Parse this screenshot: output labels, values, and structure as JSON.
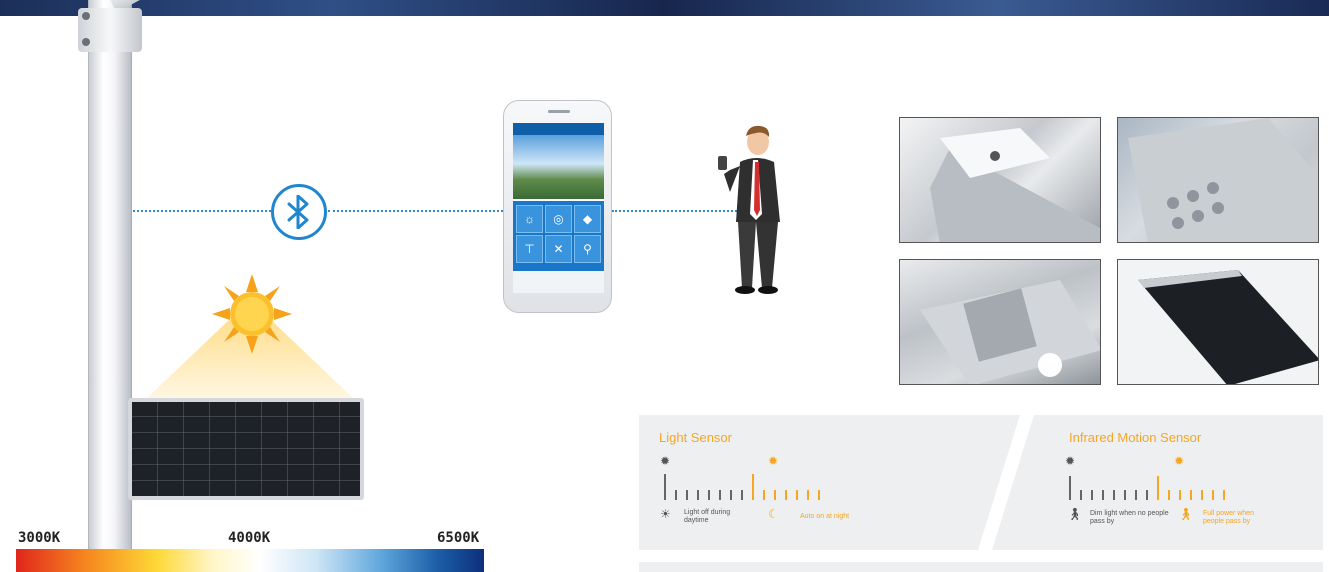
{
  "color_temperature": {
    "labels": [
      "3000K",
      "4000K",
      "6500K"
    ]
  },
  "sensors": {
    "light": {
      "title": "Light Sensor",
      "off_text": "Light off during daytime",
      "on_text": "Auto on at night"
    },
    "motion": {
      "title": "Infrared Motion Sensor",
      "dim_text": "Dim light when no people pass by",
      "full_text": "Full power when people pass by"
    }
  },
  "colors": {
    "accent_orange": "#f5a623",
    "bluetooth_blue": "#1f86cf",
    "sensor_bg": "#eeeff0"
  },
  "icons": [
    "bluetooth-icon",
    "sun-icon",
    "moon-icon",
    "lamp-icon",
    "person-icon"
  ]
}
